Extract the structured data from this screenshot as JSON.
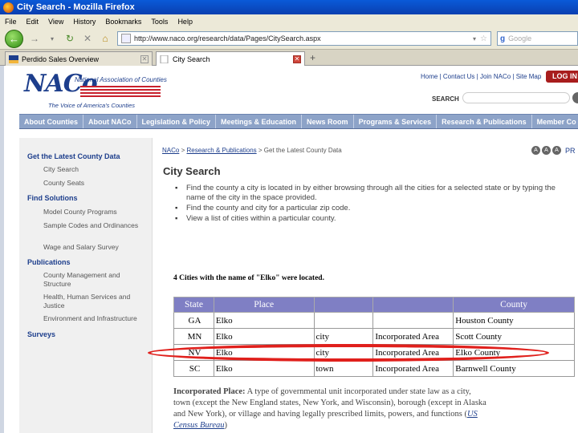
{
  "browser": {
    "title": "City Search - Mozilla Firefox",
    "menu": [
      "File",
      "Edit",
      "View",
      "History",
      "Bookmarks",
      "Tools",
      "Help"
    ],
    "url": "http://www.naco.org/research/data/Pages/CitySearch.aspx",
    "search_placeholder": "Google",
    "tabs": [
      {
        "label": "Perdido Sales Overview",
        "active": false
      },
      {
        "label": "City Search",
        "active": true
      }
    ]
  },
  "header": {
    "logo_letters": "NACo",
    "org_name": "National Association of Counties",
    "tagline": "The Voice of America's Counties",
    "top_links": "Home | Contact Us | Join NACo | Site Map",
    "login_label": "LOG IN",
    "search_label": "SEARCH"
  },
  "nav": {
    "items": [
      "About Counties",
      "About NACo",
      "Legislation & Policy",
      "Meetings & Education",
      "News Room",
      "Programs & Services",
      "Research & Publications",
      "Member Co"
    ]
  },
  "sidebar": {
    "sections": [
      {
        "heading": "Get the Latest County Data",
        "items": [
          "City Search",
          "County Seats"
        ]
      },
      {
        "heading": "Find Solutions",
        "items": [
          "Model County Programs",
          "Sample Codes and Ordinances",
          "Wage and Salary Survey"
        ]
      },
      {
        "heading": "Publications",
        "items": [
          "County Management and Structure",
          "Health, Human Services and Justice",
          "Environment and Infrastructure"
        ]
      },
      {
        "heading": "Surveys",
        "items": []
      }
    ]
  },
  "content": {
    "breadcrumb": {
      "home": "NACo",
      "section": "Research & Publications",
      "sep": ">",
      "current": "Get the Latest County Data"
    },
    "font_tools": [
      "A",
      "A",
      "A"
    ],
    "print_label": "PR",
    "title": "City Search",
    "bullets": [
      "Find the county a city is located in by either browsing through all the cities for a selected state or by typing the name of the city in the space provided.",
      "Find the county and city for a particular zip code.",
      "View a list of cities within a particular county."
    ],
    "result_count": "4 Cities with the name of \"Elko\" were located.",
    "table": {
      "headers": [
        "State",
        "Place",
        "",
        "",
        "County"
      ],
      "rows": [
        [
          "GA",
          "Elko",
          "",
          "",
          "Houston County"
        ],
        [
          "MN",
          "Elko",
          "city",
          "Incorporated Area",
          "Scott County"
        ],
        [
          "NV",
          "Elko",
          "city",
          "Incorporated Area",
          "Elko County"
        ],
        [
          "SC",
          "Elko",
          "town",
          "Incorporated Area",
          "Barnwell County"
        ]
      ],
      "highlighted_row": 2
    },
    "definition": {
      "term": "Incorporated Place:",
      "text": " A type of governmental unit incorporated under state law as a city, town (except the New England states, New York, and Wisconsin), borough (except in Alaska and New York), or village and having legally prescribed limits, powers, and functions (",
      "link": "US Census Bureau",
      "close": ")"
    }
  },
  "colors": {
    "brand_blue": "#1d3e8c",
    "nav_bg": "#8da3c8",
    "table_header": "#7f7fc4",
    "highlight_circle": "#e0201c",
    "login_red": "#a81d1d"
  }
}
